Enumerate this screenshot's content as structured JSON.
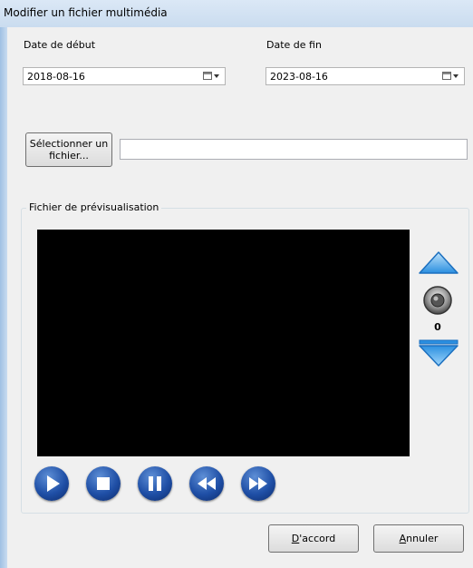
{
  "window": {
    "title": "Modifier un fichier multimédia"
  },
  "dates": {
    "start_label": "Date de début",
    "start_value": "2018-08-16",
    "end_label": "Date de fin",
    "end_value": "2023-08-16"
  },
  "file": {
    "select_button_line1": "Sélectionner un",
    "select_button_line2": "fichier...",
    "path_value": ""
  },
  "preview": {
    "group_title": "Fichier de prévisualisation",
    "volume_value": "0",
    "controls": [
      "play-icon",
      "stop-icon",
      "pause-icon",
      "rewind-icon",
      "fast-forward-icon"
    ]
  },
  "footer": {
    "ok_label_accel": "D",
    "ok_label_rest": "'accord",
    "cancel_label_accel": "A",
    "cancel_label_rest": "nnuler"
  },
  "colors": {
    "accent_blue": "#1f4fa6",
    "volume_blue": "#4aa3e8",
    "video_background": "#000000"
  }
}
